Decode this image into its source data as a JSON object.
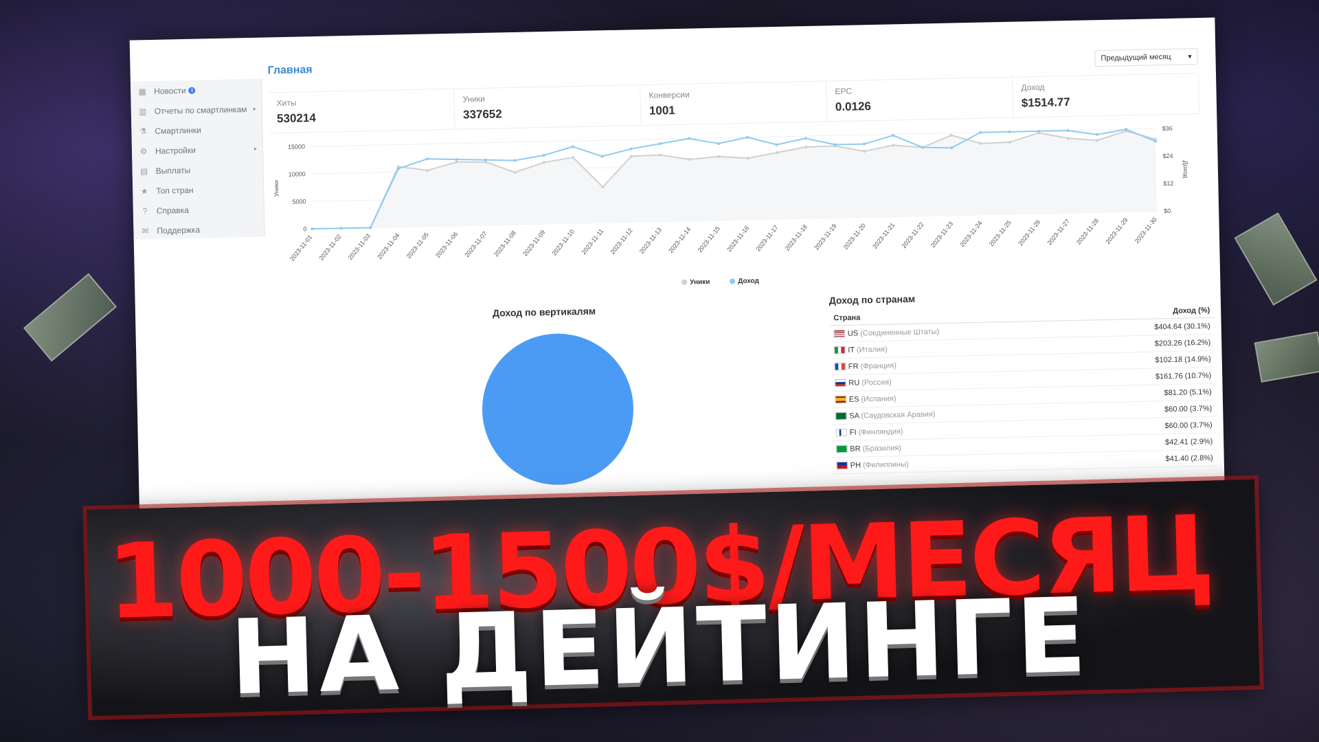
{
  "sidebar": {
    "items": [
      {
        "label": "Новости",
        "icon": "calendar-icon",
        "badge": "i",
        "arrow": ""
      },
      {
        "label": "Отчеты по смартлинкам",
        "icon": "bar-chart-icon",
        "badge": "",
        "arrow": "▸"
      },
      {
        "label": "Смартлинки",
        "icon": "flask-icon",
        "badge": "",
        "arrow": ""
      },
      {
        "label": "Настройки",
        "icon": "gear-icon",
        "badge": "",
        "arrow": "▸"
      },
      {
        "label": "Выплаты",
        "icon": "briefcase-icon",
        "badge": "",
        "arrow": ""
      },
      {
        "label": "Топ стран",
        "icon": "star-icon",
        "badge": "",
        "arrow": ""
      },
      {
        "label": "Справка",
        "icon": "help-icon",
        "badge": "",
        "arrow": ""
      },
      {
        "label": "Поддержка",
        "icon": "envelope-icon",
        "badge": "",
        "arrow": ""
      }
    ]
  },
  "header": {
    "title": "Главная",
    "period": "Предыдущий месяц"
  },
  "stats": [
    {
      "label": "Хиты",
      "value": "530214"
    },
    {
      "label": "Уники",
      "value": "337652"
    },
    {
      "label": "Конверсии",
      "value": "1001"
    },
    {
      "label": "EPC",
      "value": "0.0126"
    },
    {
      "label": "Доход",
      "value": "$1514.77"
    }
  ],
  "chart_data": {
    "type": "line",
    "x": [
      "2023-11-01",
      "2023-11-02",
      "2023-11-03",
      "2023-11-04",
      "2023-11-05",
      "2023-11-06",
      "2023-11-07",
      "2023-11-08",
      "2023-11-09",
      "2023-11-10",
      "2023-11-11",
      "2023-11-12",
      "2023-11-13",
      "2023-11-14",
      "2023-11-15",
      "2023-11-16",
      "2023-11-17",
      "2023-11-18",
      "2023-11-19",
      "2023-11-20",
      "2023-11-21",
      "2023-11-22",
      "2023-11-23",
      "2023-11-24",
      "2023-11-25",
      "2023-11-26",
      "2023-11-27",
      "2023-11-28",
      "2023-11-29",
      "2023-11-30"
    ],
    "ylabel": "Уники",
    "y2label": "Доход",
    "ylim": [
      0,
      15000
    ],
    "y_ticks": [
      "0",
      "5000",
      "10000",
      "15000"
    ],
    "y2lim": [
      0,
      36
    ],
    "y2_ticks": [
      "$0",
      "$12",
      "$24",
      "$36"
    ],
    "series": [
      {
        "name": "Уники",
        "color": "#d0d0d0",
        "axis": "left",
        "values": [
          0,
          0,
          0,
          11000,
          10200,
          11600,
          11500,
          9500,
          11200,
          12000,
          6500,
          12000,
          12100,
          11200,
          11600,
          11200,
          12100,
          13000,
          13100,
          12000,
          13000,
          12500,
          14600,
          13000,
          13100,
          14700,
          13600,
          13100,
          14700,
          13100
        ]
      },
      {
        "name": "Доход",
        "color": "#8fcbf0",
        "axis": "right",
        "values": [
          0,
          0,
          0,
          25.5,
          29.5,
          29,
          28.5,
          28,
          30,
          33.5,
          29,
          32,
          34,
          37,
          33.5,
          36.5,
          32.5,
          35,
          32,
          32,
          35.5,
          30,
          29.5,
          38,
          36.5,
          38.5,
          37,
          34,
          37.5,
          30.5
        ]
      }
    ],
    "legend": [
      "Уники",
      "Доход"
    ],
    "legend_position": "bottom"
  },
  "pie": {
    "title": "Доход по вертикалям",
    "color": "#4b9bf5"
  },
  "countries": {
    "title": "Доход по странам",
    "col_country": "Страна",
    "col_income": "Доход (%)",
    "rows": [
      {
        "code": "US",
        "name": "(Соединенные Штаты)",
        "income": "$404.64 (30.1%)",
        "flag": "us"
      },
      {
        "code": "IT",
        "name": "(Италия)",
        "income": "$203.26 (16.2%)",
        "flag": "it"
      },
      {
        "code": "FR",
        "name": "(Франция)",
        "income": "$102.18 (14.9%)",
        "flag": "fr"
      },
      {
        "code": "RU",
        "name": "(Россия)",
        "income": "$161.76 (10.7%)",
        "flag": "ru"
      },
      {
        "code": "ES",
        "name": "(Испания)",
        "income": "$81.20 (5.1%)",
        "flag": "es"
      },
      {
        "code": "SA",
        "name": "(Саудовская Аравия)",
        "income": "$60.00 (3.7%)",
        "flag": "sa"
      },
      {
        "code": "FI",
        "name": "(Финляндия)",
        "income": "$60.00 (3.7%)",
        "flag": "fi"
      },
      {
        "code": "BR",
        "name": "(Бразилия)",
        "income": "$42.41 (2.9%)",
        "flag": "br"
      },
      {
        "code": "PH",
        "name": "(Филиппины)",
        "income": "$41.40 (2.8%)",
        "flag": "ph"
      }
    ]
  },
  "headline": {
    "line1": "1000-1500$/МЕСЯЦ",
    "line2": "НА ДЕЙТИНГЕ"
  }
}
